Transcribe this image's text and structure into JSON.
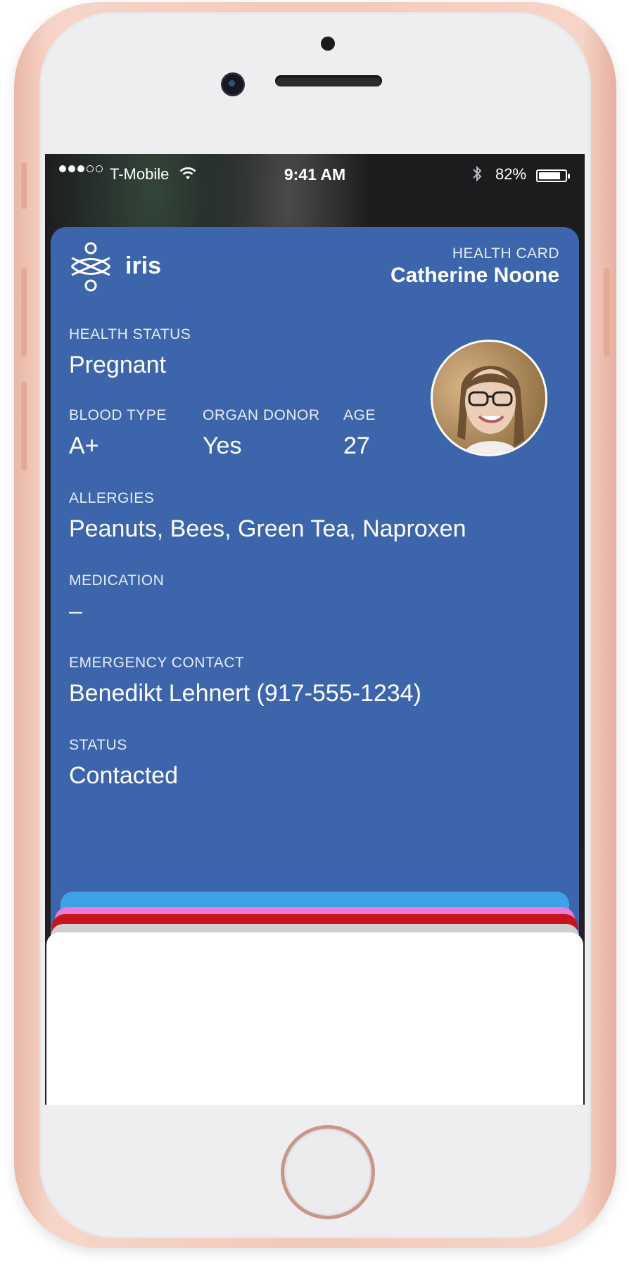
{
  "status_bar": {
    "carrier": "T-Mobile",
    "time": "9:41 AM",
    "battery_percent": "82%",
    "battery_level": 0.82,
    "signal_bars_filled": 3,
    "signal_bars_total": 5
  },
  "card": {
    "brand": "iris",
    "card_label": "HEALTH CARD",
    "holder_name": "Catherine Noone",
    "background_color": "#3d65ab",
    "fields": {
      "health_status": {
        "label": "HEALTH STATUS",
        "value": "Pregnant"
      },
      "blood_type": {
        "label": "BLOOD TYPE",
        "value": "A+"
      },
      "organ_donor": {
        "label": "ORGAN DONOR",
        "value": "Yes"
      },
      "age": {
        "label": "AGE",
        "value": "27"
      },
      "allergies": {
        "label": "ALLERGIES",
        "value": "Peanuts, Bees, Green Tea, Naproxen"
      },
      "medication": {
        "label": "MEDICATION",
        "value": "–"
      },
      "emergency_contact": {
        "label": "EMERGENCY CONTACT",
        "value": "Benedikt Lehnert (917-555-1234)"
      },
      "status": {
        "label": "STATUS",
        "value": "Contacted"
      }
    },
    "icons": {
      "logo": "iris-logo-icon",
      "share": "share-icon",
      "info": "info-icon"
    }
  },
  "pass_stack_colors": [
    "#3ea3e6",
    "#e97bd9",
    "#c8141e",
    "#cfcfd1",
    "#ffffff"
  ]
}
